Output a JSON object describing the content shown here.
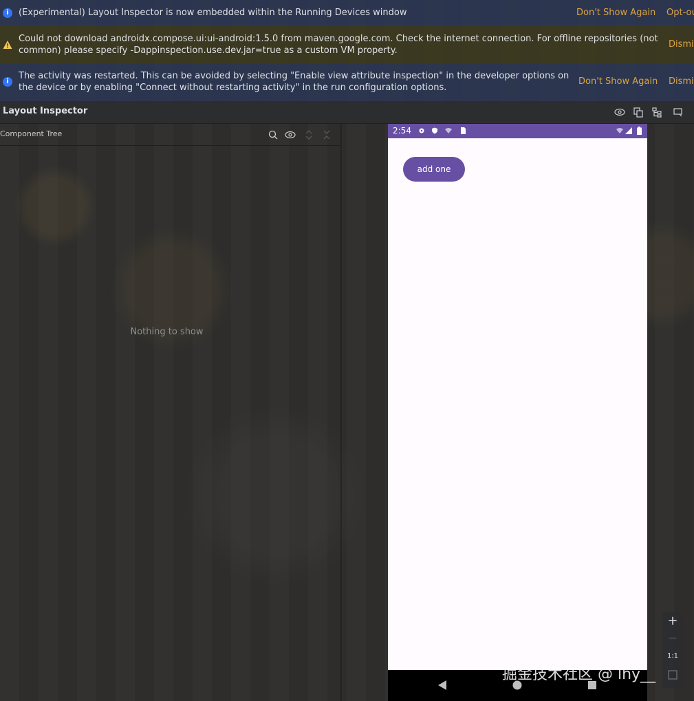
{
  "banners": [
    {
      "type": "info",
      "text": "(Experimental) Layout Inspector is now embedded within the Running Devices window",
      "actions": [
        "Don't Show Again",
        "Opt-ou"
      ]
    },
    {
      "type": "warning",
      "text_line1": "Could not download androidx.compose.ui:ui-android:1.5.0 from maven.google.com. Check the internet connection. For offline repositories (not",
      "text_line2": "common) please specify -Dappinspection.use.dev.jar=true as a custom VM property.",
      "actions": [
        "Dismis"
      ]
    },
    {
      "type": "info",
      "text_line1": "The activity was restarted. This can be avoided by selecting \"Enable view attribute inspection\" in the developer options on",
      "text_line2": "the device or by enabling \"Connect without restarting activity\" in the run configuration options.",
      "actions": [
        "Don't Show Again",
        "Dismis"
      ]
    }
  ],
  "panel": {
    "title": "Layout Inspector",
    "toolbar_icons": [
      "eye-icon",
      "copy-icon",
      "tree-layers-icon",
      "screen-icon"
    ]
  },
  "component_tree": {
    "label": "Component Tree",
    "icons": [
      "search-icon",
      "eye-icon",
      "expand-icon",
      "collapse-icon"
    ],
    "empty_text": "Nothing to show"
  },
  "device": {
    "status_time": "2:54",
    "button_label": "add one",
    "accent": "#6750a4",
    "screen_bg": "#fffbfe"
  },
  "zoom": {
    "plus": "+",
    "minus": "—",
    "ratio": "1:1"
  },
  "watermark": "掘金技术社区 @ lhy__"
}
